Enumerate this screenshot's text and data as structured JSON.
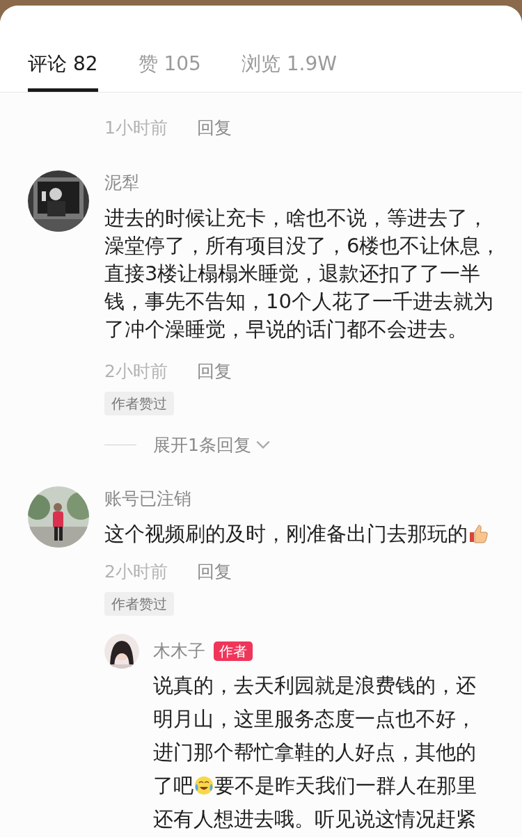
{
  "tabs": [
    {
      "label": "评论 82",
      "selected": true
    },
    {
      "label": "赞 105",
      "selected": false
    },
    {
      "label": "浏览 1.9W",
      "selected": false
    }
  ],
  "top_meta": {
    "time": "1小时前",
    "reply": "回复"
  },
  "comments": [
    {
      "name": "泥犁",
      "lines": [
        [
          {
            "kind": "text",
            "text": "进去的时候让充卡，啥也不说，等进去了，"
          }
        ],
        [
          {
            "kind": "text",
            "text": "澡堂停了，所有项目没了，6楼也不让休息，"
          }
        ],
        [
          {
            "kind": "text",
            "text": "直接3楼让榻榻米睡觉，退款还扣了了一半"
          }
        ],
        [
          {
            "kind": "text",
            "text": "钱，事先不告知，10个人花了一千进去就为"
          }
        ],
        [
          {
            "kind": "text",
            "text": "了冲个澡睡觉，早说的话门都不会进去。"
          }
        ]
      ],
      "time": "2小时前",
      "reply": "回复",
      "tag": "作者赞过",
      "expand": "展开1条回复"
    },
    {
      "name": "账号已注销",
      "lines": [
        [
          {
            "kind": "text",
            "text": "这个视频刷的及时，刚准备出门去那玩的"
          },
          {
            "kind": "thumbsup"
          }
        ]
      ],
      "time": "2小时前",
      "reply": "回复",
      "tag": "作者赞过",
      "replies": [
        {
          "name": "木木子",
          "badge": "作者",
          "lines": [
            [
              {
                "kind": "text",
                "text": "说真的，去天利园就是浪费钱的，还"
              }
            ],
            [
              {
                "kind": "text",
                "text": "明月山，这里服务态度一点也不好，"
              }
            ],
            [
              {
                "kind": "text",
                "text": "进门那个帮忙拿鞋的人好点，其他的"
              }
            ],
            [
              {
                "kind": "text",
                "text": "了吧"
              },
              {
                "kind": "laughing"
              },
              {
                "kind": "text",
                "text": "要不是昨天我们一群人在那里"
              }
            ],
            [
              {
                "kind": "text",
                "text": "还有人想进去哦。听见说这情况赶紧"
              }
            ]
          ]
        }
      ]
    }
  ]
}
